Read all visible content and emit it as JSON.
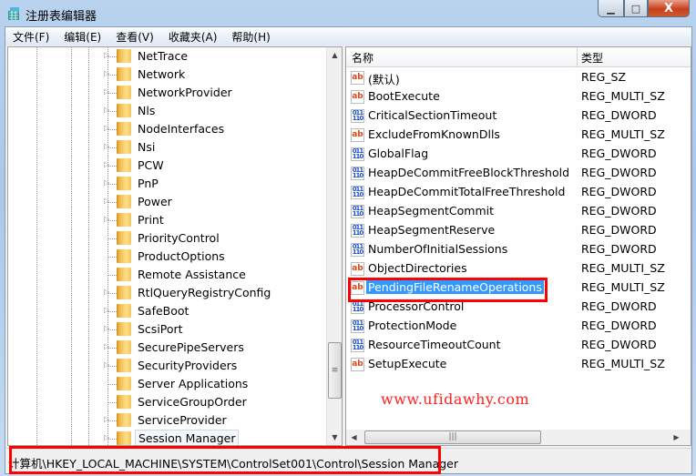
{
  "window": {
    "title": "注册表编辑器",
    "minimize": "▁",
    "maximize": "□",
    "close": "X"
  },
  "menu": [
    "文件(F)",
    "编辑(E)",
    "查看(V)",
    "收藏夹(A)",
    "帮助(H)"
  ],
  "tree": [
    {
      "label": "NetTrace",
      "expandable": true
    },
    {
      "label": "Network",
      "expandable": true
    },
    {
      "label": "NetworkProvider",
      "expandable": true
    },
    {
      "label": "Nls",
      "expandable": true
    },
    {
      "label": "NodeInterfaces",
      "expandable": true
    },
    {
      "label": "Nsi",
      "expandable": true
    },
    {
      "label": "PCW",
      "expandable": true
    },
    {
      "label": "PnP",
      "expandable": true
    },
    {
      "label": "Power",
      "expandable": true
    },
    {
      "label": "Print",
      "expandable": true
    },
    {
      "label": "PriorityControl",
      "expandable": false
    },
    {
      "label": "ProductOptions",
      "expandable": false
    },
    {
      "label": "Remote Assistance",
      "expandable": false
    },
    {
      "label": "RtlQueryRegistryConfig",
      "expandable": true
    },
    {
      "label": "SafeBoot",
      "expandable": true
    },
    {
      "label": "ScsiPort",
      "expandable": true
    },
    {
      "label": "SecurePipeServers",
      "expandable": true
    },
    {
      "label": "SecurityProviders",
      "expandable": true
    },
    {
      "label": "Server Applications",
      "expandable": false
    },
    {
      "label": "ServiceGroupOrder",
      "expandable": false
    },
    {
      "label": "ServiceProvider",
      "expandable": true
    },
    {
      "label": "Session Manager",
      "expandable": true,
      "selected": true
    }
  ],
  "columns": {
    "name": "名称",
    "type": "类型"
  },
  "values": [
    {
      "name": "(默认)",
      "type": "REG_SZ",
      "icon": "string-value-icon"
    },
    {
      "name": "BootExecute",
      "type": "REG_MULTI_SZ",
      "icon": "string-value-icon"
    },
    {
      "name": "CriticalSectionTimeout",
      "type": "REG_DWORD",
      "icon": "binary-value-icon"
    },
    {
      "name": "ExcludeFromKnownDlls",
      "type": "REG_MULTI_SZ",
      "icon": "string-value-icon"
    },
    {
      "name": "GlobalFlag",
      "type": "REG_DWORD",
      "icon": "binary-value-icon"
    },
    {
      "name": "HeapDeCommitFreeBlockThreshold",
      "type": "REG_DWORD",
      "icon": "binary-value-icon"
    },
    {
      "name": "HeapDeCommitTotalFreeThreshold",
      "type": "REG_DWORD",
      "icon": "binary-value-icon"
    },
    {
      "name": "HeapSegmentCommit",
      "type": "REG_DWORD",
      "icon": "binary-value-icon"
    },
    {
      "name": "HeapSegmentReserve",
      "type": "REG_DWORD",
      "icon": "binary-value-icon"
    },
    {
      "name": "NumberOfInitialSessions",
      "type": "REG_DWORD",
      "icon": "binary-value-icon"
    },
    {
      "name": "ObjectDirectories",
      "type": "REG_MULTI_SZ",
      "icon": "string-value-icon"
    },
    {
      "name": "PendingFileRenameOperations",
      "type": "REG_MULTI_SZ",
      "icon": "string-value-icon",
      "selected": true
    },
    {
      "name": "ProcessorControl",
      "type": "REG_DWORD",
      "icon": "binary-value-icon"
    },
    {
      "name": "ProtectionMode",
      "type": "REG_DWORD",
      "icon": "binary-value-icon"
    },
    {
      "name": "ResourceTimeoutCount",
      "type": "REG_DWORD",
      "icon": "binary-value-icon"
    },
    {
      "name": "SetupExecute",
      "type": "REG_MULTI_SZ",
      "icon": "string-value-icon"
    }
  ],
  "watermark": "www.ufidawhy.com",
  "status": {
    "path": "计算机\\HKEY_LOCAL_MACHINE\\SYSTEM\\ControlSet001\\Control\\Session Manager"
  },
  "colors": {
    "highlight": "#3399ff",
    "annotation": "#ff0000"
  }
}
